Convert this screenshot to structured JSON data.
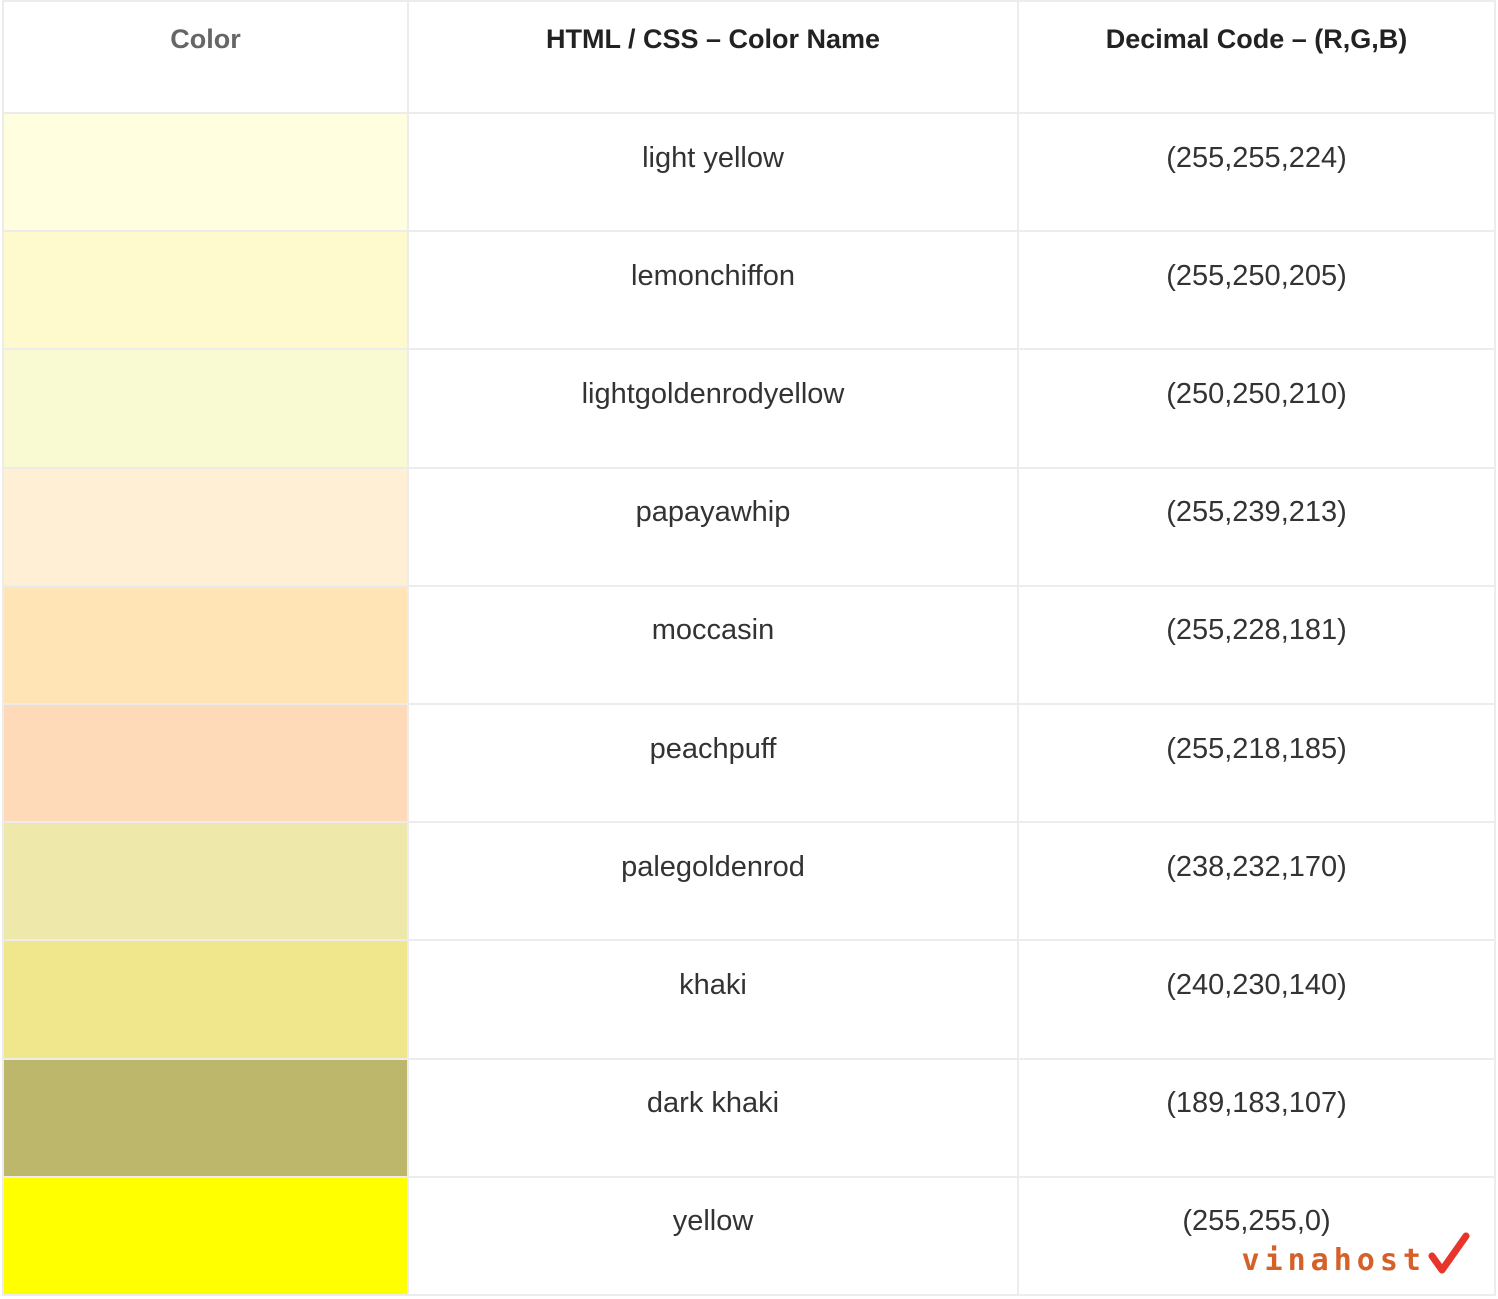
{
  "header": {
    "color": "Color",
    "name": "HTML / CSS – Color Name",
    "rgb": "Decimal Code – (R,G,B)"
  },
  "rows": [
    {
      "name": "light yellow",
      "rgb": "(255,255,224)",
      "swatch": "#ffffe0"
    },
    {
      "name": "lemonchiffon",
      "rgb": "(255,250,205)",
      "swatch": "#fffacd"
    },
    {
      "name": "lightgoldenrodyellow",
      "rgb": "(250,250,210)",
      "swatch": "#fafad2"
    },
    {
      "name": "papayawhip",
      "rgb": "(255,239,213)",
      "swatch": "#ffefd5"
    },
    {
      "name": "moccasin",
      "rgb": "(255,228,181)",
      "swatch": "#ffe4b5"
    },
    {
      "name": "peachpuff",
      "rgb": "(255,218,185)",
      "swatch": "#ffdab9"
    },
    {
      "name": "palegoldenrod",
      "rgb": "(238,232,170)",
      "swatch": "#eee8aa"
    },
    {
      "name": "khaki",
      "rgb": "(240,230,140)",
      "swatch": "#f0e68c"
    },
    {
      "name": "dark khaki",
      "rgb": "(189,183,107)",
      "swatch": "#bdb76b"
    },
    {
      "name": "yellow",
      "rgb": "(255,255,0)",
      "swatch": "#ffff00"
    }
  ],
  "watermark": {
    "text": "vinahost",
    "accent_color": "#e8352c",
    "text_color": "#d6602a"
  }
}
